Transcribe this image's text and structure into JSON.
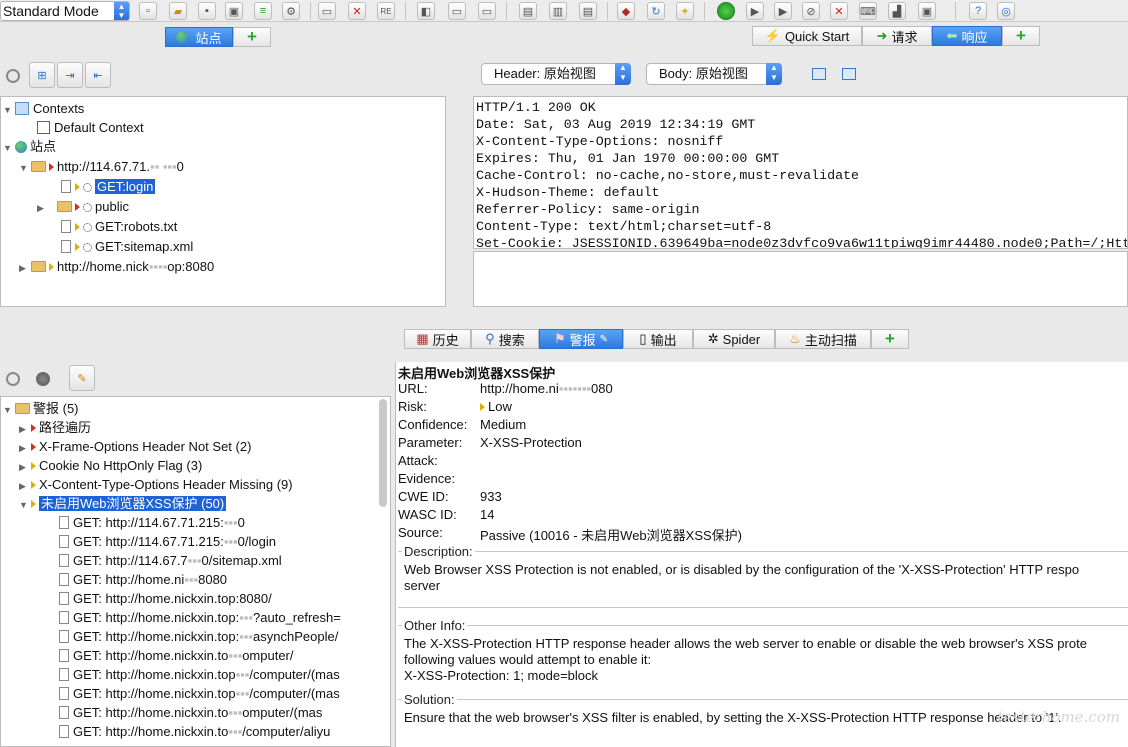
{
  "toolbar": {
    "mode": "Standard Mode"
  },
  "left_tabs": {
    "sites": "站点"
  },
  "right_tabs": {
    "quick_start": "Quick Start",
    "request": "请求",
    "response": "响应"
  },
  "view_selects": {
    "header": "Header: 原始视图",
    "body": "Body: 原始视图"
  },
  "site_tree": {
    "contexts": "Contexts",
    "default_context": "Default Context",
    "sites": "站点",
    "host1": "http://114.67.71.",
    "host1_suffix": "0",
    "get_login": "GET:login",
    "public": "public",
    "robots": "GET:robots.txt",
    "sitemap": "GET:sitemap.xml",
    "host2": "http://home.nick",
    "host2_suffix": "op:8080"
  },
  "response_header": {
    "lines": [
      "HTTP/1.1 200 OK",
      "Date: Sat, 03 Aug 2019 12:34:19 GMT",
      "X-Content-Type-Options: nosniff",
      "Expires: Thu, 01 Jan 1970 00:00:00 GMT",
      "Cache-Control: no-cache,no-store,must-revalidate",
      "X-Hudson-Theme: default",
      "Referrer-Policy: same-origin",
      "Content-Type: text/html;charset=utf-8",
      "Set-Cookie: JSESSIONID.639649ba=node0z3dvfco9va6w11tpiwg9imr44480.node0;Path=/;Htt"
    ]
  },
  "bottom_tabs": {
    "history": "历史",
    "search": "搜索",
    "alerts": "警报",
    "output": "输出",
    "spider": "Spider",
    "active_scan": "主动扫描"
  },
  "alert_tree": {
    "root": "警报 (5)",
    "categories": [
      "路径遍历",
      "X-Frame-Options Header Not Set (2)",
      "Cookie No HttpOnly Flag (3)",
      "X-Content-Type-Options Header Missing (9)",
      "未启用Web浏览器XSS保护 (50)"
    ],
    "items": [
      "GET: http://114.67.71.215:",
      "GET: http://114.67.71.215:",
      "GET: http://114.67.7",
      "GET: http://home.ni",
      "GET: http://home.nickxin.top:8080/",
      "GET: http://home.nickxin.top:",
      "GET: http://home.nickxin.top:",
      "GET: http://home.nickxin.to",
      "GET: http://home.nickxin.top",
      "GET: http://home.nickxin.top",
      "GET: http://home.nickxin.to",
      "GET: http://home.nickxin.to"
    ],
    "item_suffixes": [
      "0",
      "0/login",
      "0/sitemap.xml",
      "8080",
      "",
      "?auto_refresh=",
      "asynchPeople/",
      "omputer/",
      "/computer/(mas",
      "/computer/(mas",
      "omputer/(mas",
      "/computer/aliyu"
    ]
  },
  "alert_detail": {
    "title": "未启用Web浏览器XSS保护",
    "url_label": "URL:",
    "url_value": "http://home.ni",
    "url_suffix": "080",
    "risk_label": "Risk:",
    "risk_value": "Low",
    "confidence_label": "Confidence:",
    "confidence_value": "Medium",
    "parameter_label": "Parameter:",
    "parameter_value": "X-XSS-Protection",
    "attack_label": "Attack:",
    "evidence_label": "Evidence:",
    "cwe_label": "CWE ID:",
    "cwe_value": "933",
    "wasc_label": "WASC ID:",
    "wasc_value": "14",
    "source_label": "Source:",
    "source_value": "Passive (10016 - 未启用Web浏览器XSS保护)",
    "description_title": "Description:",
    "description_line1": "Web Browser XSS Protection is not enabled, or is disabled by the configuration of the 'X-XSS-Protection' HTTP respo",
    "description_line2": "server",
    "other_title": "Other Info:",
    "other_line1": "The X-XSS-Protection HTTP response header allows the web server to enable or disable the web browser's XSS prote",
    "other_line2": "following values would attempt to enable it:",
    "other_line3": "X-XSS-Protection: 1; mode=block",
    "solution_title": "Solution:",
    "solution_line1": "Ensure that the web browser's XSS filter is enabled, by setting the X-XSS-Protection HTTP response header to '1'."
  },
  "watermark": "testerhome.com"
}
